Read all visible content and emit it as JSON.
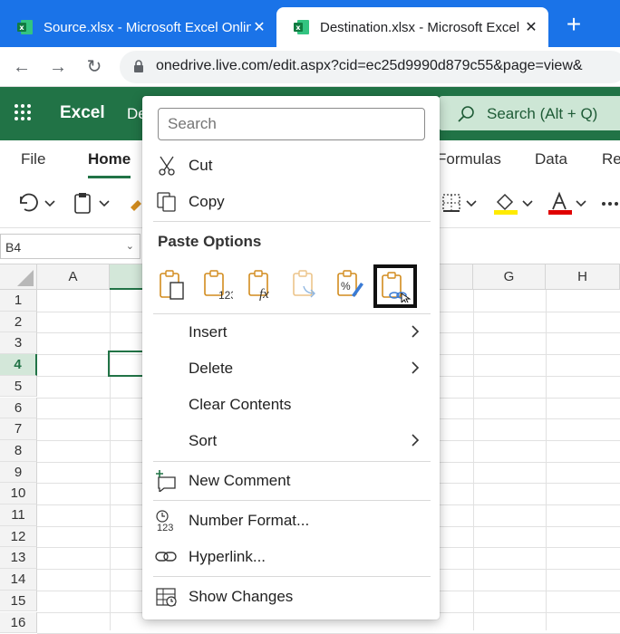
{
  "browser": {
    "tabs": [
      {
        "title": "Source.xlsx - Microsoft Excel Online",
        "active": false
      },
      {
        "title": "Destination.xlsx - Microsoft Excel Online",
        "active": true
      }
    ],
    "url": "onedrive.live.com/edit.aspx?cid=ec25d9990d879c55&page=view&"
  },
  "excel": {
    "app_name": "Excel",
    "doc_name_fragment": "De",
    "search_placeholder": "Search (Alt + Q)",
    "ribbon_tabs": [
      "File",
      "Home",
      "Formulas",
      "Data",
      "Re"
    ],
    "active_ribbon_tab": "Home",
    "name_box": "B4",
    "columns": [
      "A",
      "G",
      "H"
    ],
    "rows": [
      "1",
      "2",
      "3",
      "4",
      "5",
      "6",
      "7",
      "8",
      "9",
      "10",
      "11",
      "12",
      "13",
      "14",
      "15",
      "16"
    ],
    "selected_row": "4"
  },
  "context_menu": {
    "search_placeholder": "Search",
    "cut": "Cut",
    "copy": "Copy",
    "paste_options_title": "Paste Options",
    "paste_icons": [
      "paste-icon",
      "paste-values-icon",
      "paste-formulas-icon",
      "paste-transpose-icon",
      "paste-formatting-icon",
      "paste-link-icon"
    ],
    "insert": "Insert",
    "delete": "Delete",
    "clear_contents": "Clear Contents",
    "sort": "Sort",
    "new_comment": "New Comment",
    "number_format": "Number Format...",
    "hyperlink": "Hyperlink...",
    "show_changes": "Show Changes",
    "values_icon_label": "123",
    "formula_icon_label": "fx"
  },
  "colors": {
    "excel_green": "#217346",
    "chrome_blue": "#1a73e8",
    "highlight_yellow": "#ffeb00",
    "font_red": "#e00000"
  }
}
